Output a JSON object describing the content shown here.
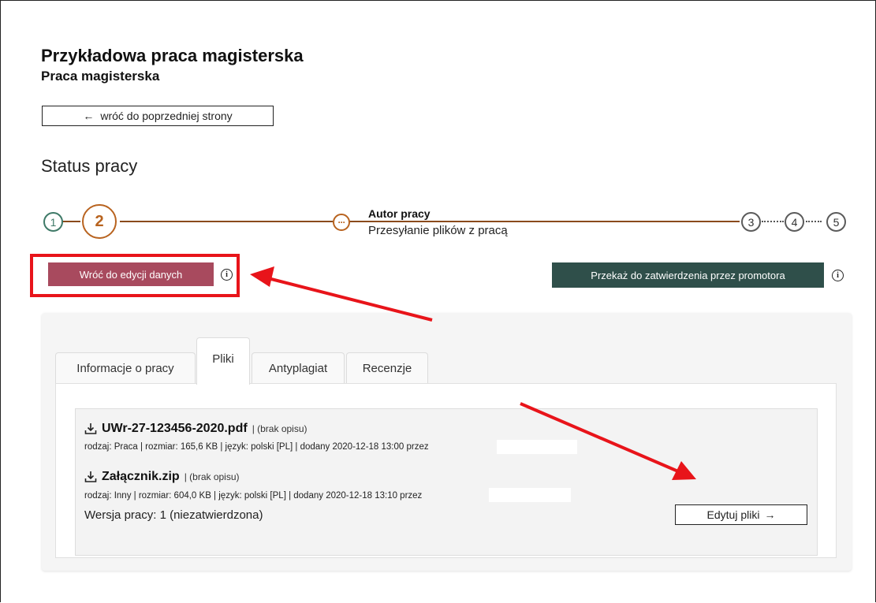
{
  "header": {
    "title": "Przykładowa praca magisterska",
    "subtitle": "Praca magisterska",
    "back_label": "wróć do poprzedniej strony",
    "back_arrow": "←"
  },
  "status": {
    "heading": "Status pracy",
    "steps": [
      "1",
      "2",
      "3",
      "4",
      "5"
    ],
    "current_step_title": "Autor pracy",
    "current_step_subtitle": "Przesyłanie plików z pracą",
    "dots_glyph": "···"
  },
  "actions": {
    "edit_data_label": "Wróć do edycji danych",
    "forward_label": "Przekaż do zatwierdzenia przez promotora",
    "info_glyph": "i"
  },
  "tabs": [
    {
      "label": "Informacje o pracy",
      "active": false
    },
    {
      "label": "Pliki",
      "active": true
    },
    {
      "label": "Antyplagiat",
      "active": false
    },
    {
      "label": "Recenzje",
      "active": false
    }
  ],
  "files": [
    {
      "name": "UWr-27-123456-2020.pdf",
      "description": " | (brak opisu)",
      "meta": "rodzaj: Praca | rozmiar: 165,6 KB | język: polski [PL] | dodany 2020-12-18 13:00 przez"
    },
    {
      "name": "Załącznik.zip",
      "description": " | (brak opisu)",
      "meta": "rodzaj: Inny | rozmiar: 604,0 KB | język: polski [PL] | dodany 2020-12-18 13:10 przez"
    }
  ],
  "version_text": "Wersja pracy: 1 (niezatwierdzona)",
  "edit_files": {
    "label": "Edytuj pliki",
    "arrow": "→"
  },
  "colors": {
    "highlight": "#e8141a",
    "brand_brown": "#b8631f",
    "edit_data_btn": "#a84a5e",
    "forward_btn": "#2f4f4a",
    "step_done": "#3f7a68"
  }
}
